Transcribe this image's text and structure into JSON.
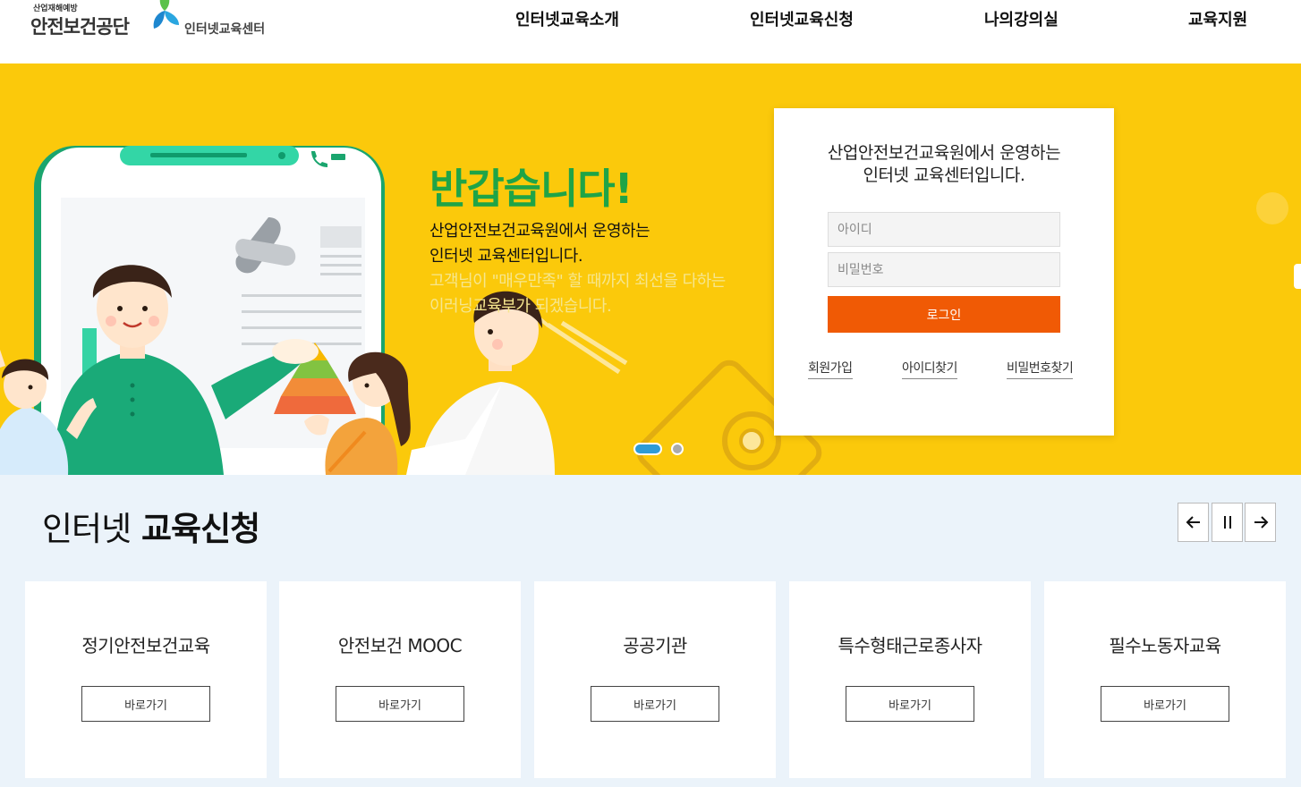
{
  "header": {
    "logo": {
      "org_small": "산업재해예방",
      "org_name": "안전보건공단",
      "center_name": "인터넷교육센터"
    },
    "menu": [
      {
        "label": "인터넷교육소개"
      },
      {
        "label": "인터넷교육신청"
      },
      {
        "label": "나의강의실"
      },
      {
        "label": "교육지원"
      }
    ]
  },
  "hero": {
    "title": "반갑습니다!",
    "desc_line1": "산업안전보건교육원에서 운영하는",
    "desc_line2": "인터넷 교육센터입니다.",
    "desc_line3": "고객님이 \"매우만족\" 할 때까지 최선을 다하는",
    "desc_line4": "이러닝교육부가 되겠습니다.",
    "slides": {
      "total": 2,
      "active": 1
    },
    "colors": {
      "background": "#fbc90b",
      "title": "#1fa447",
      "accent_text": "#f6e68e"
    }
  },
  "login": {
    "title_line1": "산업안전보건교육원에서 운영하는",
    "title_line2": "인터넷 교육센터입니다.",
    "id_placeholder": "아이디",
    "pw_placeholder": "비밀번호",
    "login_label": "로그인",
    "links": {
      "signup": "회원가입",
      "find_id": "아이디찾기",
      "find_pw": "비밀번호찾기"
    },
    "colors": {
      "button": "#f05a05"
    }
  },
  "apply": {
    "title_thin": "인터넷",
    "title_bold": "교육신청",
    "controls": {
      "prev": "prev-arrow-icon",
      "pause": "pause-icon",
      "next": "next-arrow-icon"
    },
    "cards": [
      {
        "title": "정기안전보건교육",
        "button": "바로가기"
      },
      {
        "title": "안전보건 MOOC",
        "button": "바로가기"
      },
      {
        "title": "공공기관",
        "button": "바로가기"
      },
      {
        "title": "특수형태근로종사자",
        "button": "바로가기"
      },
      {
        "title": "필수노동자교육",
        "button": "바로가기"
      }
    ],
    "colors": {
      "background": "#ebf3fa"
    }
  }
}
